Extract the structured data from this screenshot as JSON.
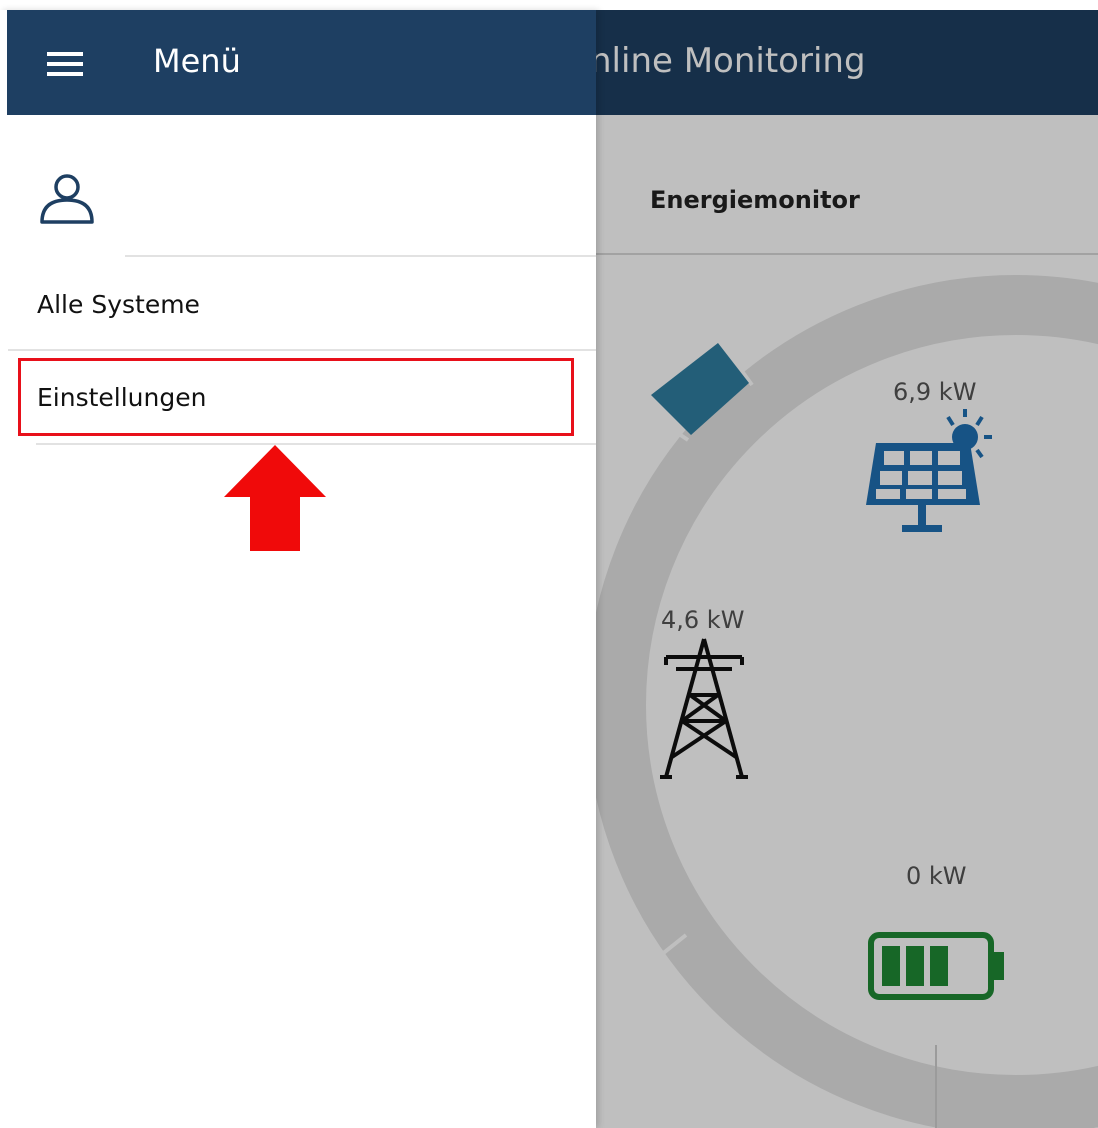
{
  "app": {
    "title": "nline Monitoring",
    "card_title": "Energiemonitor",
    "solar_power": "6,9 kW",
    "grid_power": "4,6 kW",
    "battery_power": "0 kW",
    "colors": {
      "header": "#1e3f62",
      "solar": "#1f6fb2",
      "battery": "#1f8a35",
      "ring_active": "#2f7ea0",
      "highlight": "#e8101a"
    }
  },
  "drawer": {
    "title": "Menü",
    "menu_icon": "hamburger-icon",
    "user_icon": "user-icon",
    "items": [
      {
        "label": "Alle Systeme"
      },
      {
        "label": "Einstellungen"
      }
    ]
  }
}
